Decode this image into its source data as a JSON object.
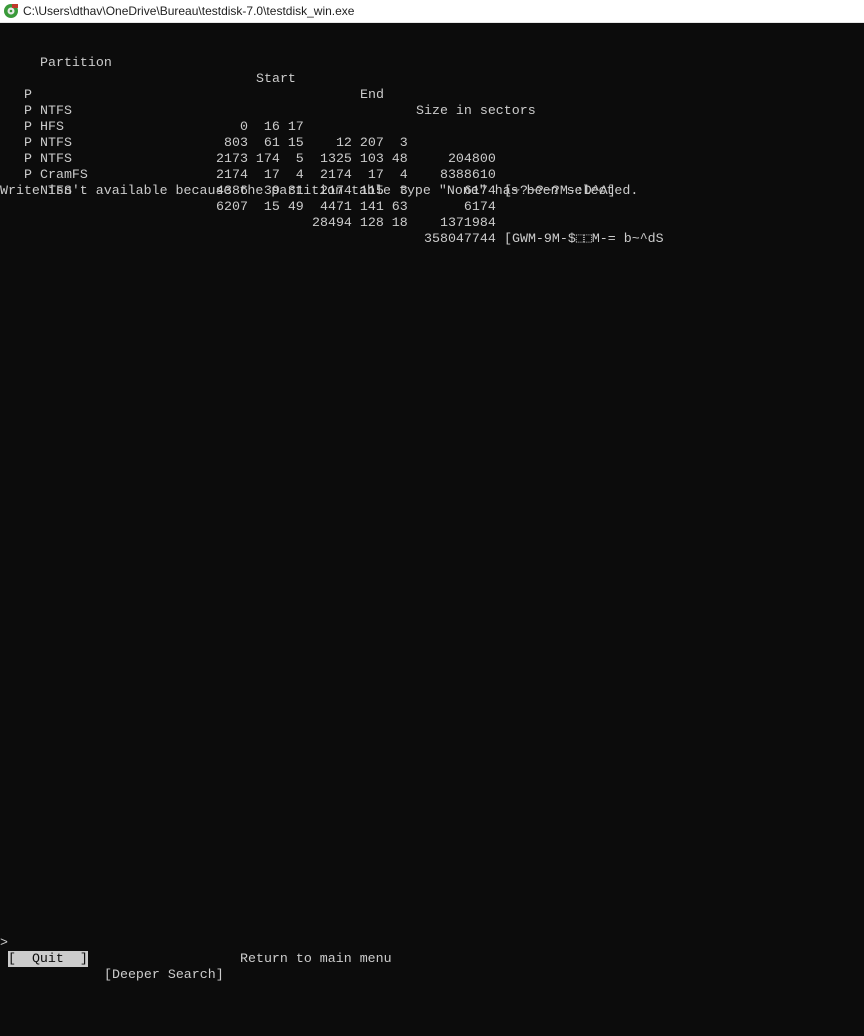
{
  "window": {
    "title": "C:\\Users\\dthav\\OneDrive\\Bureau\\testdisk-7.0\\testdisk_win.exe",
    "icon": "testdisk-app-icon"
  },
  "header": {
    "partition": "Partition",
    "start": "Start",
    "end": "End",
    "size": "Size in sectors"
  },
  "partitions": [
    {
      "flag": "P",
      "type": "NTFS",
      "start": "   0  16 17",
      "end": "   12 207  3",
      "size": "   204800",
      "label": ""
    },
    {
      "flag": "P",
      "type": "HFS",
      "start": " 803  61 15",
      "end": " 1325 103 48",
      "size": "  8388610",
      "label": "[~?~?~?M-:D^A]"
    },
    {
      "flag": "P",
      "type": "NTFS",
      "start": "2173 174  5",
      "end": " 2174  17  4",
      "size": "     6174",
      "label": ""
    },
    {
      "flag": "P",
      "type": "NTFS",
      "start": "2174  17  4",
      "end": " 2174 115  3",
      "size": "     6174",
      "label": ""
    },
    {
      "flag": "P",
      "type": "CramFS",
      "start": "4386  39 31",
      "end": " 4471 141 63",
      "size": "  1371984",
      "label": "[GWM-9M-$⬚⬚M-= b~^dS"
    },
    {
      "flag": "P",
      "type": "NTFS",
      "start": "6207  15 49",
      "end": "28494 128 18",
      "size": "358047744",
      "label": ""
    }
  ],
  "message": "Write isn't available because the partition table type \"None\" has been selected.",
  "menu": {
    "cursor": ">",
    "quit": "[  Quit  ]",
    "deeper": "[Deeper Search]",
    "hint": "Return to main menu"
  },
  "colors": {
    "background": "#0c0c0c",
    "foreground": "#cccccc",
    "titlebar": "#ffffff"
  }
}
